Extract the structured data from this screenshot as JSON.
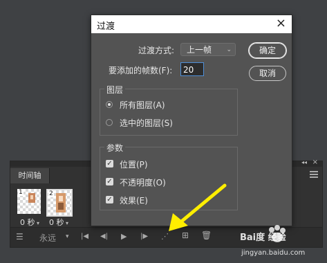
{
  "timeline": {
    "tab_label": "时间轴",
    "collapse_glyph": "◂◂",
    "close_glyph": "×",
    "frames": [
      {
        "number": "1",
        "delay": "0 秒"
      },
      {
        "number": "2",
        "delay": "0 秒"
      }
    ],
    "toolbar": {
      "loop_value": "永远"
    }
  },
  "dialog": {
    "title": "过渡",
    "method_label": "过渡方式:",
    "method_value": "上一帧",
    "frames_label": "要添加的帧数(F):",
    "frames_value": "20",
    "ok_label": "确定",
    "cancel_label": "取消",
    "layers_group": {
      "title": "图层",
      "options": [
        "所有图层(A)",
        "选中的图层(S)"
      ],
      "selected_index": 0
    },
    "params_group": {
      "title": "参数",
      "options": [
        "位置(P)",
        "不透明度(O)",
        "效果(E)"
      ]
    }
  },
  "colors": {
    "annotation_arrow": "#ffee00",
    "input_focus": "#4f90d9"
  },
  "watermark": {
    "line1": "Bai度 经验",
    "line2": "jingyan.baidu.com"
  }
}
